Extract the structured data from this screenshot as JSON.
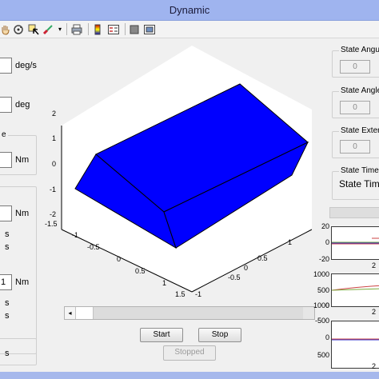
{
  "window": {
    "title": "Dynamic"
  },
  "toolbar": {
    "icons": [
      "pan-icon",
      "rotate-icon",
      "data-cursor-icon",
      "brush-icon",
      "print-icon",
      "colorbar-icon",
      "legend-icon",
      "hide-plot-tools-icon",
      "show-plot-tools-icon"
    ]
  },
  "left": {
    "rate_unit": "deg/s",
    "angle_unit": "deg",
    "torque_fragment": "e",
    "torque_unit": "Nm",
    "torque2_unit": "Nm",
    "s1": "s",
    "s2": "s",
    "torque3_value": "1",
    "torque3_unit": "Nm",
    "s3": "s",
    "s4": "s",
    "s5": "s"
  },
  "plot": {
    "z_ticks": [
      "2",
      "1",
      "0",
      "-1",
      "-2"
    ],
    "x_ticks": [
      "-1.5",
      "-1",
      "-0.5",
      "0",
      "0.5",
      "1",
      "1.5"
    ],
    "y_ticks": [
      "1.5",
      "1",
      "0.5",
      "0",
      "-0.5",
      "-1"
    ],
    "body_color": "#0000ff"
  },
  "controls": {
    "start_label": "Start",
    "stop_label": "Stop",
    "status_label": "Stopped"
  },
  "right": {
    "panel1_title": "State Angula",
    "panel1_value": "0",
    "panel2_title": "State Angle",
    "panel2_value": "0",
    "panel3_title": "State Extern",
    "panel3_value": "0",
    "panel4_title": "State Time",
    "panel4_text": "State Time",
    "mini1_ticks": [
      "20",
      "0",
      "-20"
    ],
    "mini1_xtick": "2",
    "mini2_ticks": [
      "1000",
      "500",
      "0"
    ],
    "mini2_xtick": "2",
    "mini3_ticks": [
      "1000",
      "-500",
      "0",
      "500"
    ],
    "mini3_xtick": "2"
  }
}
